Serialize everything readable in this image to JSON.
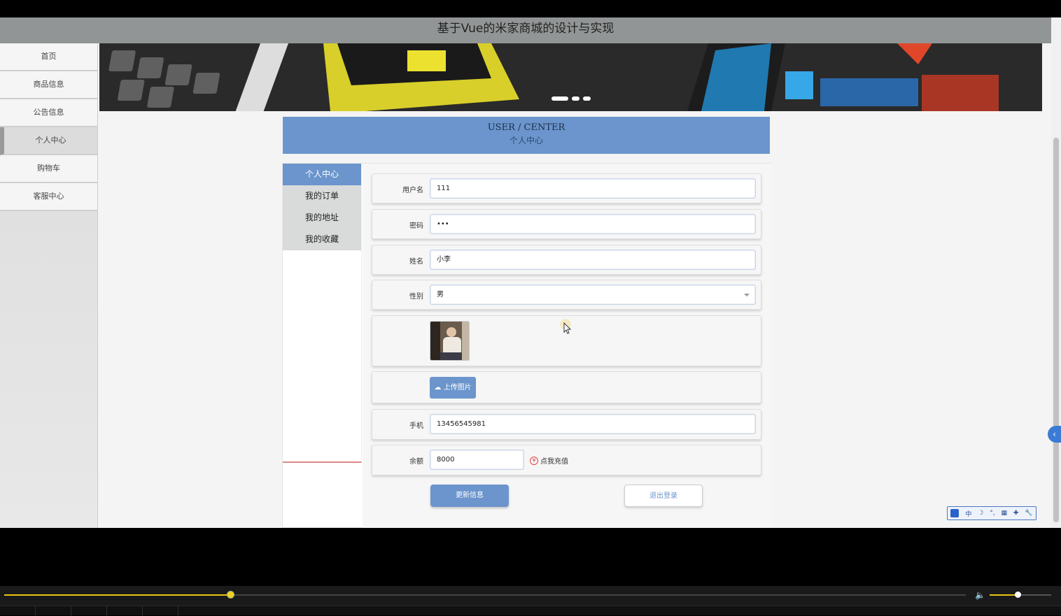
{
  "header": {
    "title": "基于Vue的米家商城的设计与实现"
  },
  "sidebar": {
    "items": [
      {
        "label": "首页"
      },
      {
        "label": "商品信息"
      },
      {
        "label": "公告信息"
      },
      {
        "label": "个人中心"
      },
      {
        "label": "购物车"
      },
      {
        "label": "客服中心"
      }
    ],
    "active_index": 3
  },
  "banner": {
    "slide_count": 3
  },
  "user_center": {
    "title_en": "USER / CENTER",
    "title_cn": "个人中心"
  },
  "subnav": {
    "items": [
      {
        "label": "个人中心"
      },
      {
        "label": "我的订单"
      },
      {
        "label": "我的地址"
      },
      {
        "label": "我的收藏"
      }
    ],
    "active_index": 0
  },
  "form": {
    "username": {
      "label": "用户名",
      "value": "111"
    },
    "password": {
      "label": "密码",
      "value": "•••"
    },
    "name": {
      "label": "姓名",
      "value": "小李"
    },
    "gender": {
      "label": "性别",
      "value": "男"
    },
    "upload_label": "上传图片",
    "phone": {
      "label": "手机",
      "value": "13456545981"
    },
    "balance": {
      "label": "余额",
      "value": "8000"
    },
    "recharge_label": "点我充值",
    "update_label": "更新信息",
    "logout_label": "退出登录"
  },
  "ime": {
    "items": [
      "中",
      "☽",
      "°,",
      "▦",
      "✚",
      "🔧"
    ]
  },
  "player": {
    "progress": 0.235,
    "volume": 0.45
  },
  "colors": {
    "accent": "#6b95cc",
    "topbar": "#929595",
    "progress": "#e8c617"
  }
}
